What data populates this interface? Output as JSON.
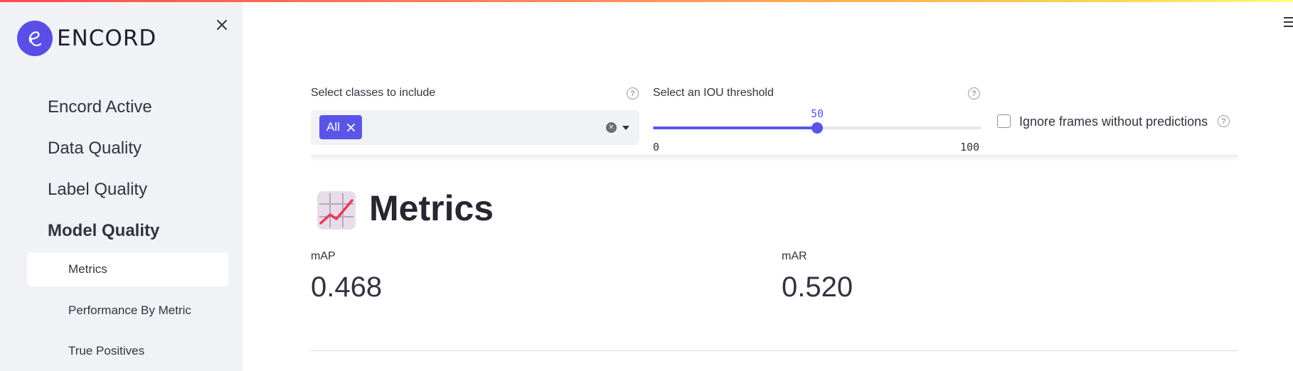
{
  "brand": {
    "name": "ENCORD",
    "accent": "#5a55e6"
  },
  "sidebar": {
    "items": [
      {
        "label": "Encord Active"
      },
      {
        "label": "Data Quality"
      },
      {
        "label": "Label Quality"
      },
      {
        "label": "Model Quality"
      }
    ],
    "sub_items": [
      {
        "label": "Metrics"
      },
      {
        "label": "Performance By Metric"
      },
      {
        "label": "True Positives"
      }
    ],
    "active_item": "Model Quality",
    "active_sub_item": "Metrics"
  },
  "filters": {
    "classes_label": "Select classes to include",
    "selected_tag": "All",
    "iou_label": "Select an IOU threshold",
    "iou_value": "50",
    "iou_min": "0",
    "iou_max": "100",
    "iou_fraction": 0.5,
    "ignore_label": "Ignore frames without predictions",
    "ignore_checked": false
  },
  "main": {
    "title": "Metrics",
    "title_icon": "chart-increasing-icon",
    "metrics": [
      {
        "label": "mAP",
        "value": "0.468"
      },
      {
        "label": "mAR",
        "value": "0.520"
      }
    ]
  }
}
